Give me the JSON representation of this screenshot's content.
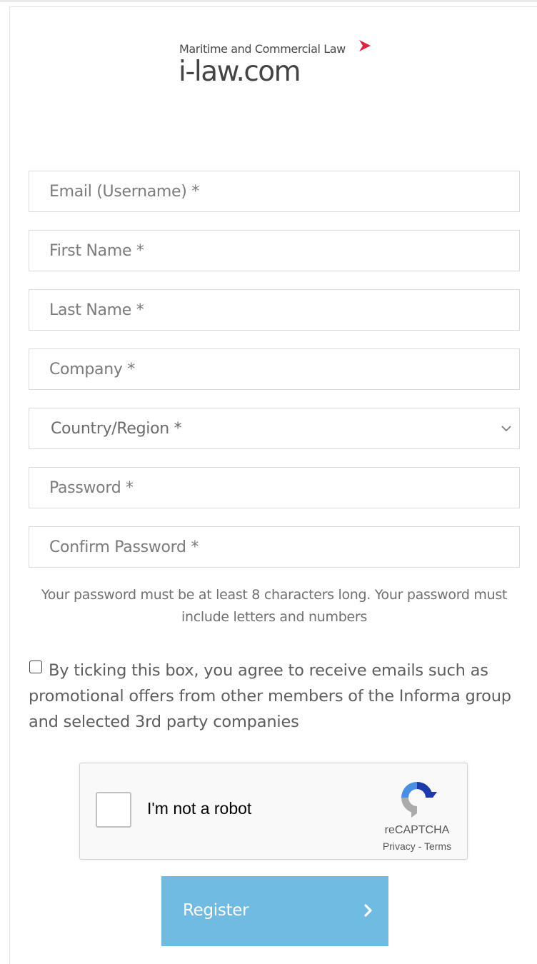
{
  "logo": {
    "tagline": "Maritime and Commercial Law",
    "name": "i-law.com",
    "accent_color": "#e2233d"
  },
  "form": {
    "email_placeholder": "Email (Username) *",
    "first_name_placeholder": "First Name *",
    "last_name_placeholder": "Last Name *",
    "company_placeholder": "Company *",
    "country_selected": "Country/Region *",
    "password_placeholder": "Password *",
    "confirm_password_placeholder": "Confirm Password *",
    "password_hint": "Your password must be at least 8 characters long. Your password must include letters and numbers",
    "consent_text": "By ticking this box, you agree to receive emails such as promotional offers from other members of the Informa group and selected 3rd party companies",
    "consent_checked": false
  },
  "recaptcha": {
    "label": "I'm not a robot",
    "brand": "reCAPTCHA",
    "links": "Privacy - Terms",
    "checked": false
  },
  "register": {
    "label": "Register",
    "color": "#70bbe1"
  }
}
